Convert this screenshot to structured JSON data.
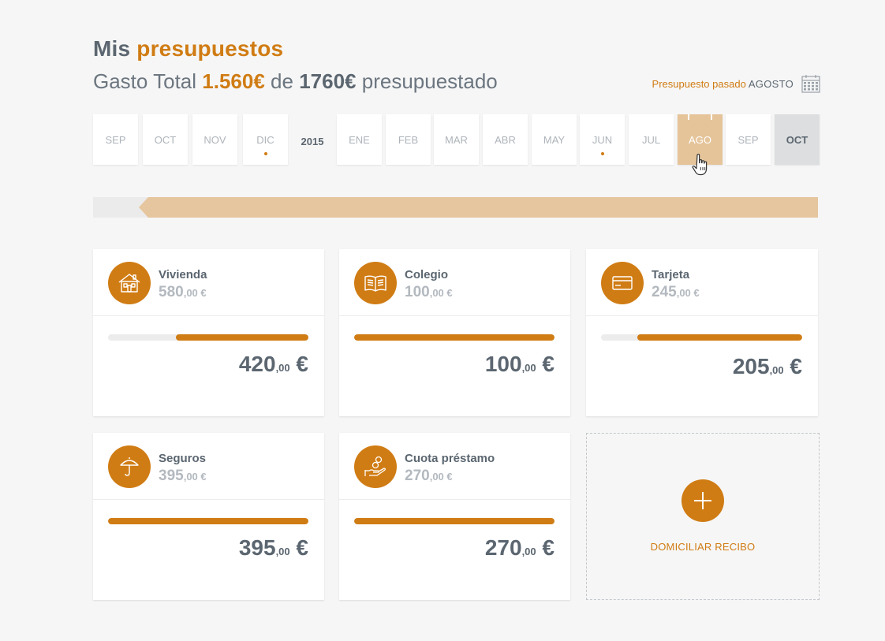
{
  "header": {
    "title_prefix": "Mis",
    "title_accent": "presupuestos",
    "gasto_label": "Gasto Total",
    "gasto_total": "1.560€",
    "de_label": "de",
    "budget_total": "1760€",
    "budget_suffix": "presupuestado"
  },
  "past_budget": {
    "label": "Presupuesto pasado",
    "month": "AGOSTO",
    "icon": "calendar-icon"
  },
  "months": {
    "year_label": "2015",
    "items": [
      {
        "label": "SEP"
      },
      {
        "label": "OCT"
      },
      {
        "label": "NOV"
      },
      {
        "label": "DIC"
      },
      {
        "label": "ENE"
      },
      {
        "label": "FEB"
      },
      {
        "label": "MAR"
      },
      {
        "label": "ABR"
      },
      {
        "label": "MAY"
      },
      {
        "label": "JUN"
      },
      {
        "label": "JUL"
      },
      {
        "label": "AGO"
      },
      {
        "label": "SEP"
      },
      {
        "label": "OCT"
      }
    ],
    "dotted_months": [
      "DIC",
      "JUN"
    ],
    "selected": "AGO",
    "current": "OCT"
  },
  "categories": [
    {
      "name": "Vivienda",
      "budget_int": "580",
      "budget_dec": ",00 €",
      "spent_int": "420",
      "spent_dec": ",00",
      "currency": "€",
      "used_fraction": 0.66,
      "icon": "house-icon"
    },
    {
      "name": "Colegio",
      "budget_int": "100",
      "budget_dec": ",00 €",
      "spent_int": "100",
      "spent_dec": ",00",
      "currency": "€",
      "used_fraction": 1.0,
      "icon": "book-icon"
    },
    {
      "name": "Tarjeta",
      "budget_int": "245",
      "budget_dec": ",00 €",
      "spent_int": "205",
      "spent_dec": ",00",
      "currency": "€",
      "used_fraction": 0.82,
      "icon": "credit-card-icon"
    },
    {
      "name": "Seguros",
      "budget_int": "395",
      "budget_dec": ",00 €",
      "spent_int": "395",
      "spent_dec": ",00",
      "currency": "€",
      "used_fraction": 1.0,
      "icon": "umbrella-icon"
    },
    {
      "name": "Cuota préstamo",
      "budget_int": "270",
      "budget_dec": ",00 €",
      "spent_int": "270",
      "spent_dec": ",00",
      "currency": "€",
      "used_fraction": 1.0,
      "icon": "hand-coins-icon"
    }
  ],
  "add_card": {
    "label": "DOMICILIAR RECIBO",
    "icon": "plus-icon"
  },
  "colors": {
    "accent": "#d07c14",
    "text": "#5b6670",
    "muted": "#b3b9bf",
    "selected_month": "#e5c49a"
  }
}
